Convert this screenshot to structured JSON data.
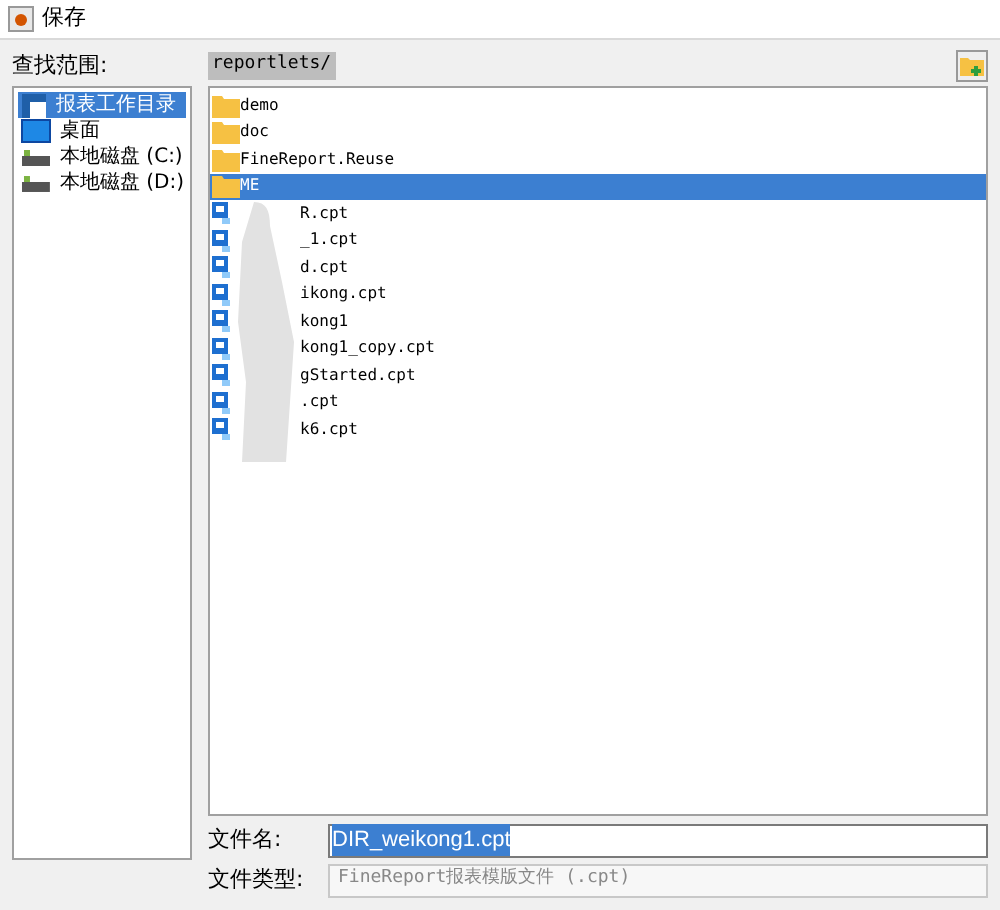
{
  "window": {
    "title": "保存"
  },
  "look_in": {
    "label": "查找范围:",
    "path": "reportlets/"
  },
  "sidebar": {
    "items": [
      {
        "label": "报表工作目录",
        "kind": "workspace",
        "selected": true
      },
      {
        "label": "桌面",
        "kind": "desktop",
        "selected": false
      },
      {
        "label": "本地磁盘 (C:)",
        "kind": "drive",
        "selected": false
      },
      {
        "label": "本地磁盘 (D:)",
        "kind": "drive",
        "selected": false
      }
    ]
  },
  "files": [
    {
      "name": "demo",
      "kind": "folder",
      "selected": false
    },
    {
      "name": "doc",
      "kind": "folder",
      "selected": false
    },
    {
      "name": "FineReport.Reuse",
      "kind": "folder",
      "selected": false
    },
    {
      "name": "ME",
      "kind": "folder",
      "selected": true
    },
    {
      "name": "R.cpt",
      "kind": "report",
      "selected": false
    },
    {
      "name": "_1.cpt",
      "kind": "report",
      "selected": false
    },
    {
      "name": "d.cpt",
      "kind": "report",
      "selected": false
    },
    {
      "name": "ikong.cpt",
      "kind": "report",
      "selected": false
    },
    {
      "name": "kong1",
      "kind": "report",
      "selected": false
    },
    {
      "name": "kong1_copy.cpt",
      "kind": "report",
      "selected": false
    },
    {
      "name": "gStarted.cpt",
      "kind": "report",
      "selected": false
    },
    {
      "name": ".cpt",
      "kind": "report",
      "selected": false
    },
    {
      "name": "k6.cpt",
      "kind": "report",
      "selected": false
    }
  ],
  "file_name": {
    "label": "文件名:",
    "value": "DIR_weikong1.cpt"
  },
  "file_type": {
    "label": "文件类型:",
    "value": "FineReport报表模版文件 (.cpt)"
  }
}
